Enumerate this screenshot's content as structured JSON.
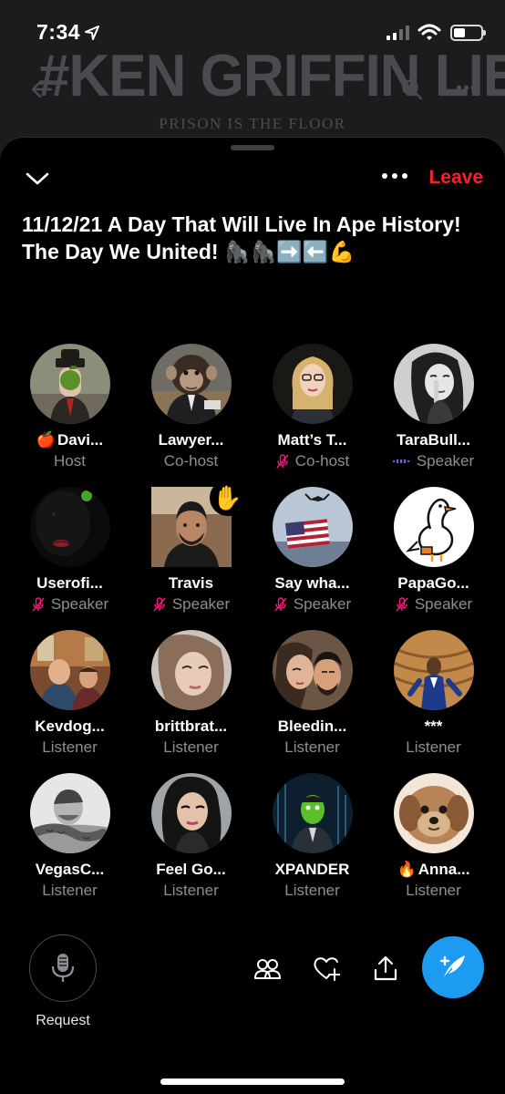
{
  "status_bar": {
    "time": "7:34"
  },
  "background_page": {
    "headline": "#KEN GRIFFIN LIED",
    "tagline": "PRISON IS THE FLOOR"
  },
  "space": {
    "leave_label": "Leave",
    "title": "11/12/21 A Day That Will Live In Ape History! The Day We United! 🦍🦍➡️⬅️💪"
  },
  "participants": [
    {
      "prefix": "🍎",
      "name": "Davi...",
      "role": "Host",
      "status": "none",
      "avatar": "apple-man-avatar"
    },
    {
      "prefix": "",
      "name": "Lawyer...",
      "role": "Co-host",
      "status": "none",
      "avatar": "chimp-avatar"
    },
    {
      "prefix": "",
      "name": "Matt’s T...",
      "role": "Co-host",
      "status": "muted",
      "avatar": "blonde-woman-avatar"
    },
    {
      "prefix": "",
      "name": "TaraBull...",
      "role": "Speaker",
      "status": "speaking",
      "avatar": "woman-bw-avatar"
    },
    {
      "prefix": "",
      "name": "Userofi...",
      "role": "Speaker",
      "status": "muted",
      "avatar": "dark-lips-avatar"
    },
    {
      "prefix": "",
      "name": "Travis",
      "role": "Speaker",
      "status": "muted",
      "avatar": "man-selfie-avatar",
      "hand": "✋"
    },
    {
      "prefix": "",
      "name": "Say wha...",
      "role": "Speaker",
      "status": "muted",
      "avatar": "flag-eagle-avatar"
    },
    {
      "prefix": "",
      "name": "PapaGo...",
      "role": "Speaker",
      "status": "muted",
      "avatar": "goose-avatar"
    },
    {
      "prefix": "",
      "name": "Kevdog...",
      "role": "Listener",
      "status": "none",
      "avatar": "group-photo-avatar"
    },
    {
      "prefix": "",
      "name": "brittbrat...",
      "role": "Listener",
      "status": "none",
      "avatar": "woman-selfie-avatar"
    },
    {
      "prefix": "",
      "name": "Bleedin...",
      "role": "Listener",
      "status": "none",
      "avatar": "couple-avatar"
    },
    {
      "prefix": "",
      "name": "***",
      "role": "Listener",
      "status": "none",
      "avatar": "suited-man-avatar"
    },
    {
      "prefix": "",
      "name": "VegasC...",
      "role": "Listener",
      "status": "none",
      "avatar": "tattoo-man-avatar"
    },
    {
      "prefix": "",
      "name": "Feel Go...",
      "role": "Listener",
      "status": "none",
      "avatar": "dark-hair-woman-avatar"
    },
    {
      "prefix": "",
      "name": "XPANDER",
      "role": "Listener",
      "status": "none",
      "avatar": "green-face-avatar"
    },
    {
      "prefix": "🔥",
      "name": "Anna...",
      "role": "Listener",
      "status": "none",
      "avatar": "dog-avatar"
    }
  ],
  "bottom_bar": {
    "request_label": "Request"
  },
  "colors": {
    "accent": "#1d9bf0",
    "leave": "#f4212e",
    "muted": "#f91880",
    "speaking": "#7856ff"
  }
}
